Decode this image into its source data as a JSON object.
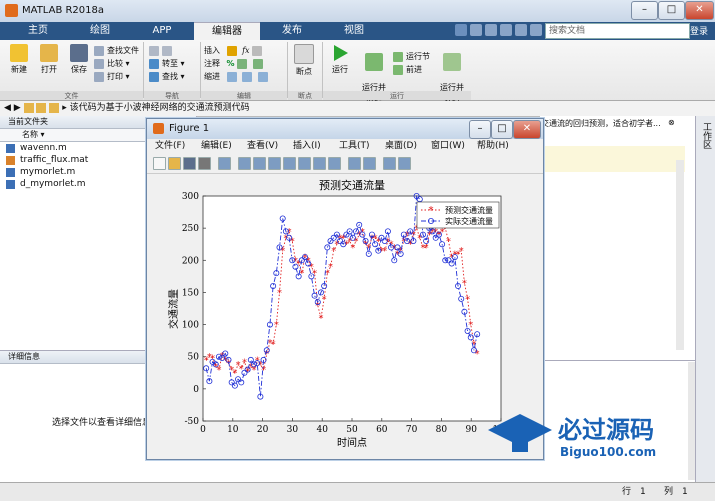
{
  "window": {
    "title": "MATLAB R2018a"
  },
  "tabs": [
    "主页",
    "绘图",
    "APP",
    "编辑器",
    "发布",
    "视图"
  ],
  "active_tab": "编辑器",
  "search": {
    "placeholder": "搜索文档"
  },
  "login_label": "登录",
  "ribbon": {
    "file": {
      "new": "新建",
      "open": "打开",
      "save": "保存",
      "find_files": "查找文件",
      "compare": "比较",
      "print": "打印",
      "group": "文件"
    },
    "navigate": {
      "goto": "转至",
      "find": "查找",
      "group": "导航"
    },
    "edit": {
      "insert": "插入",
      "comment": "注释",
      "indent": "缩进",
      "group": "编辑"
    },
    "breakpoints": {
      "label": "断点",
      "group": "断点"
    },
    "run": {
      "run": "运行",
      "run_advance": "运行并\n前进",
      "run_section": "运行节",
      "advance": "前进",
      "run_time": "运行并\n计时",
      "group": "运行"
    }
  },
  "address": {
    "path": "该代码为基于小波神经网络的交通流预测代码"
  },
  "current_folder": {
    "title": "当前文件夹",
    "column": "名称 ▾",
    "files": [
      {
        "name": "wavenn.m",
        "type": "m"
      },
      {
        "name": "traffic_flux.mat",
        "type": "mat"
      },
      {
        "name": "mymorlet.m",
        "type": "m"
      },
      {
        "name": "d_mymorlet.m",
        "type": "m"
      }
    ]
  },
  "details": {
    "title": "详细信息",
    "hint": "选择文件以查看详细信息"
  },
  "editor_snippet": "交通流的回归预测，适合初学者...",
  "workspace_label": "工作区",
  "status": {
    "row_label": "行",
    "row": "1",
    "col_label": "列",
    "col": "1"
  },
  "figure": {
    "title": "Figure 1",
    "menu": [
      "文件(F)",
      "编辑(E)",
      "查看(V)",
      "插入(I)",
      "工具(T)",
      "桌面(D)",
      "窗口(W)",
      "帮助(H)"
    ]
  },
  "chart_data": {
    "type": "line",
    "title": "预测交通流量",
    "xlabel": "时间点",
    "ylabel": "交通流量",
    "xlim": [
      0,
      100
    ],
    "ylim": [
      -50,
      300
    ],
    "xticks": [
      0,
      10,
      20,
      30,
      40,
      50,
      60,
      70,
      80,
      90,
      100
    ],
    "yticks": [
      -50,
      0,
      50,
      100,
      150,
      200,
      250,
      300
    ],
    "legend_position": "top-right",
    "series": [
      {
        "name": "预测交通流量",
        "style": "red dotted with * markers",
        "color": "#e01b1b",
        "values": [
          45,
          50,
          48,
          35,
          30,
          52,
          45,
          40,
          30,
          25,
          38,
          32,
          42,
          28,
          35,
          30,
          45,
          38,
          30,
          55,
          72,
          70,
          100,
          150,
          215,
          235,
          245,
          230,
          200,
          195,
          180,
          205,
          200,
          190,
          180,
          130,
          110,
          140,
          180,
          190,
          215,
          225,
          235,
          235,
          225,
          230,
          220,
          230,
          240,
          245,
          225,
          220,
          235,
          235,
          230,
          215,
          215,
          230,
          225,
          220,
          210,
          215,
          230,
          240,
          225,
          240,
          250,
          235,
          220,
          220,
          240,
          245,
          245,
          240,
          245,
          250,
          230,
          205,
          210,
          210,
          215,
          165,
          140,
          100,
          70,
          55
        ]
      },
      {
        "name": "实际交通流量",
        "style": "blue dash-dot with o markers",
        "color": "#1f2fd6",
        "values": [
          32,
          12,
          42,
          38,
          50,
          48,
          55,
          45,
          10,
          5,
          15,
          10,
          25,
          30,
          45,
          38,
          40,
          -12,
          45,
          60,
          100,
          160,
          180,
          220,
          265,
          245,
          235,
          200,
          190,
          175,
          200,
          205,
          195,
          175,
          145,
          135,
          150,
          160,
          220,
          230,
          235,
          240,
          230,
          225,
          240,
          245,
          235,
          245,
          255,
          240,
          230,
          210,
          240,
          225,
          215,
          235,
          230,
          245,
          220,
          200,
          220,
          210,
          240,
          230,
          245,
          230,
          300,
          295,
          240,
          230,
          250,
          245,
          235,
          240,
          225,
          200,
          200,
          195,
          205,
          160,
          140,
          120,
          90,
          80,
          60,
          85
        ]
      }
    ]
  },
  "watermark": {
    "brand": "必过源码",
    "url": "Biguo100.com"
  },
  "colors": {
    "tab_bar": "#2a5586",
    "accent": "#e06b1c",
    "series_pred": "#e01b1b",
    "series_actual": "#1f2fd6"
  }
}
